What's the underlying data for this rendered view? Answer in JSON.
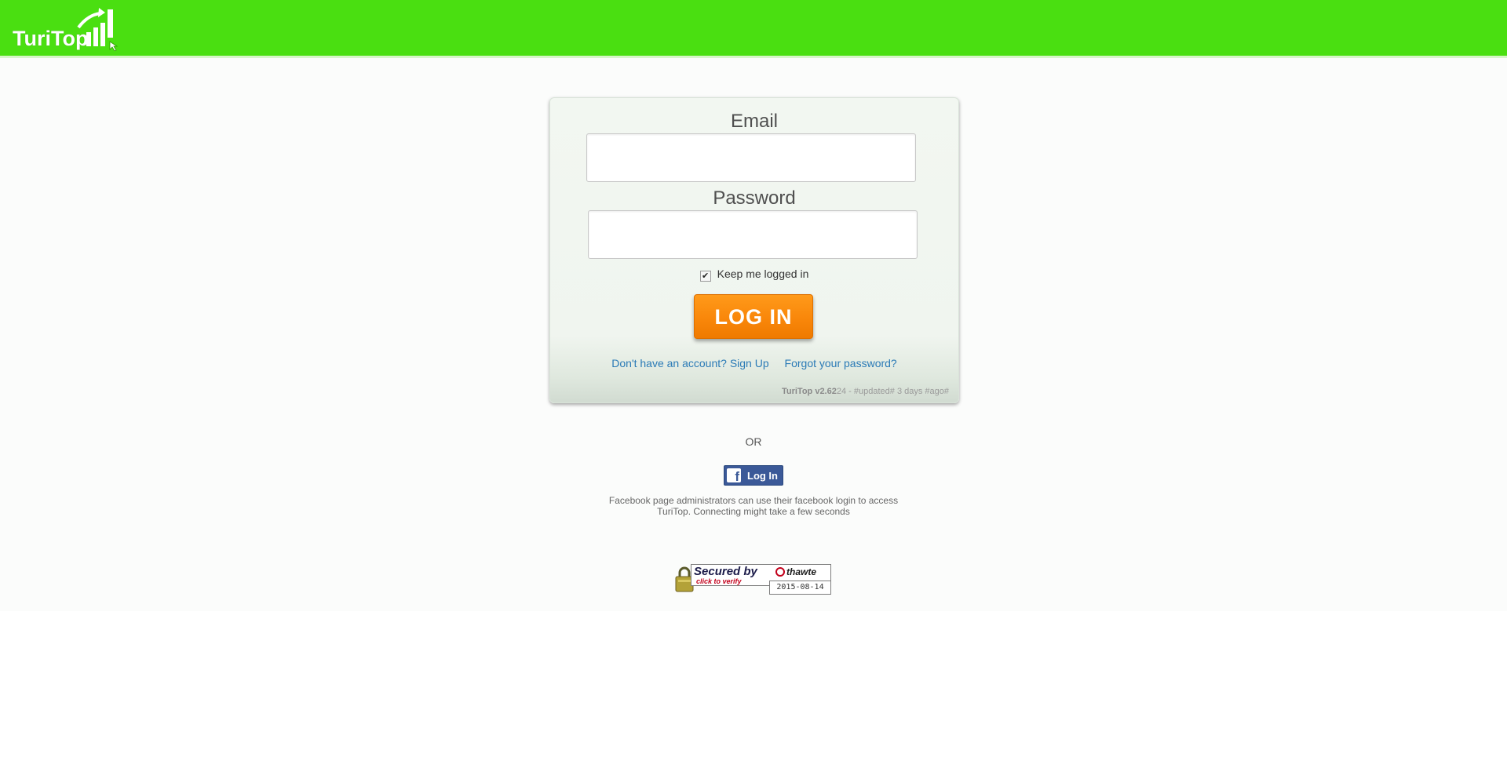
{
  "header": {
    "logo_text": "TuriTop",
    "brand_color": "#4adf11"
  },
  "login_form": {
    "email_label": "Email",
    "email_value": "",
    "password_label": "Password",
    "password_value": "",
    "keep_logged_in_label": "Keep me logged in",
    "keep_logged_in_checked": true,
    "login_button_label": "LOG IN",
    "signup_link": "Don't have an account? Sign Up",
    "forgot_link": "Forgot your password?",
    "version_name": "TuriTop v2.62",
    "version_build": "24",
    "version_updated": " - #updated# 3 days #ago#",
    "button_color": "#f9870a",
    "link_color": "#2a7ab6"
  },
  "alt_login": {
    "or_text": "OR",
    "facebook_button_label": "Log In",
    "facebook_icon": "facebook-icon",
    "facebook_note": "Facebook page administrators can use their facebook login to access TuriTop. Connecting might take a few seconds",
    "facebook_color": "#3b5998"
  },
  "seal": {
    "title": "Secured by",
    "verify": "click to verify",
    "brand": "thawte",
    "date": "2015-08-14"
  }
}
